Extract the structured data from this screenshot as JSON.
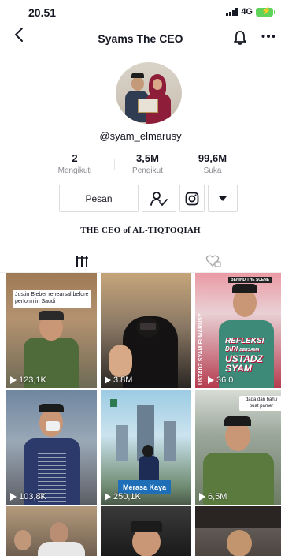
{
  "status_bar": {
    "time": "20.51",
    "network": "4G"
  },
  "nav": {
    "title": "Syams The CEO"
  },
  "profile": {
    "username": "@syam_elmarusy",
    "stats": [
      {
        "value": "2",
        "label": "Mengikuti"
      },
      {
        "value": "3,5M",
        "label": "Pengikut"
      },
      {
        "value": "99,6M",
        "label": "Suka"
      }
    ],
    "message_button": "Pesan",
    "bio": "THE CEO of AL-TIQTOQIAH"
  },
  "videos": [
    {
      "views": "123,1K",
      "caption": "Justin Bieber rehearsal before perform in Saudi"
    },
    {
      "views": "3.8M"
    },
    {
      "views": "36.0",
      "badge": "BEHIND THE SCENE",
      "overlay_lines": [
        "REFLEKSI",
        "DIRI",
        "BERSAMA",
        "USTADZ",
        "SYAM"
      ],
      "side_text": "USTADZ SYAM ELMARUSY"
    },
    {
      "views": "103,8K"
    },
    {
      "views": "250,1K",
      "caption": "Merasa Kaya"
    },
    {
      "views": "6,5M",
      "caption": "dada dan bahu buat pamer"
    },
    {
      "views": ""
    },
    {
      "views": ""
    },
    {
      "views": ""
    }
  ],
  "colors": {
    "accent_red": "#fe2c55",
    "text": "#161823",
    "muted": "#8a8b91",
    "battery": "#5fd35a"
  }
}
